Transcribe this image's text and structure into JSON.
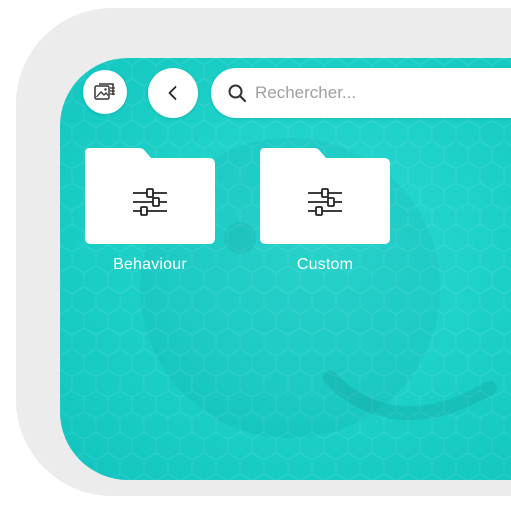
{
  "toolbar": {
    "wallpaper_icon": "wallpaper-icon",
    "back_icon": "chevron-left-icon"
  },
  "search": {
    "icon": "search-icon",
    "placeholder": "Rechercher...",
    "value": ""
  },
  "folders": [
    {
      "label": "Behaviour",
      "icon": "sliders-icon"
    },
    {
      "label": "Custom",
      "icon": "sliders-icon"
    }
  ],
  "colors": {
    "background": "#1bcfc7",
    "frame": "#ececec",
    "surface": "#ffffff",
    "icon": "#222222"
  }
}
